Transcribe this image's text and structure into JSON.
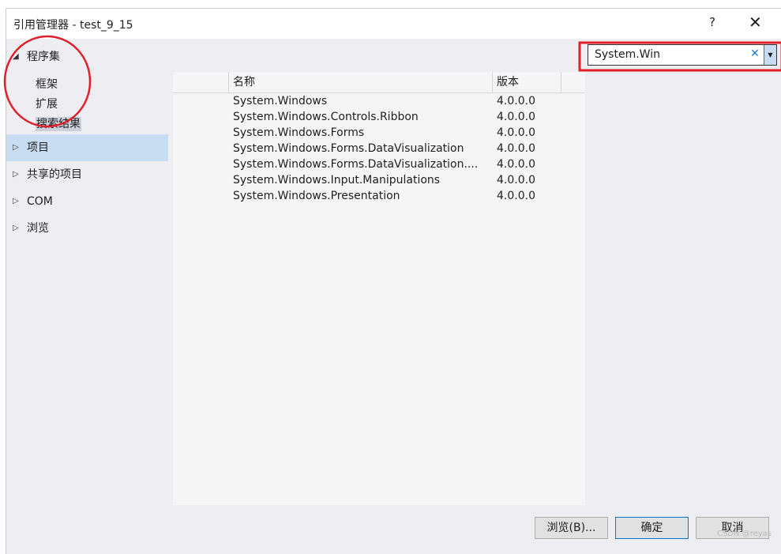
{
  "window": {
    "title": "引用管理器 - test_9_15",
    "help": "?",
    "close": "✕"
  },
  "tree": {
    "assemblies": "程序集",
    "framework": "框架",
    "extensions": "扩展",
    "search_results": "搜索结果",
    "projects": "项目",
    "shared_projects": "共享的项目",
    "com": "COM",
    "browse": "浏览"
  },
  "search": {
    "value": "System.Win",
    "clear": "✕",
    "dropdown": "▼"
  },
  "table": {
    "columns": [
      "",
      "名称",
      "版本"
    ],
    "rows": [
      {
        "name": "System.Windows",
        "version": "4.0.0.0"
      },
      {
        "name": "System.Windows.Controls.Ribbon",
        "version": "4.0.0.0"
      },
      {
        "name": "System.Windows.Forms",
        "version": "4.0.0.0"
      },
      {
        "name": "System.Windows.Forms.DataVisualization",
        "version": "4.0.0.0"
      },
      {
        "name": "System.Windows.Forms.DataVisualization....",
        "version": "4.0.0.0"
      },
      {
        "name": "System.Windows.Input.Manipulations",
        "version": "4.0.0.0"
      },
      {
        "name": "System.Windows.Presentation",
        "version": "4.0.0.0"
      }
    ]
  },
  "buttons": {
    "browse": "浏览(B)...",
    "ok": "确定",
    "cancel": "取消"
  },
  "watermark": "CSDN @reyas",
  "colors": {
    "annotation": "#e0202a",
    "selection": "#c9ddf2"
  }
}
